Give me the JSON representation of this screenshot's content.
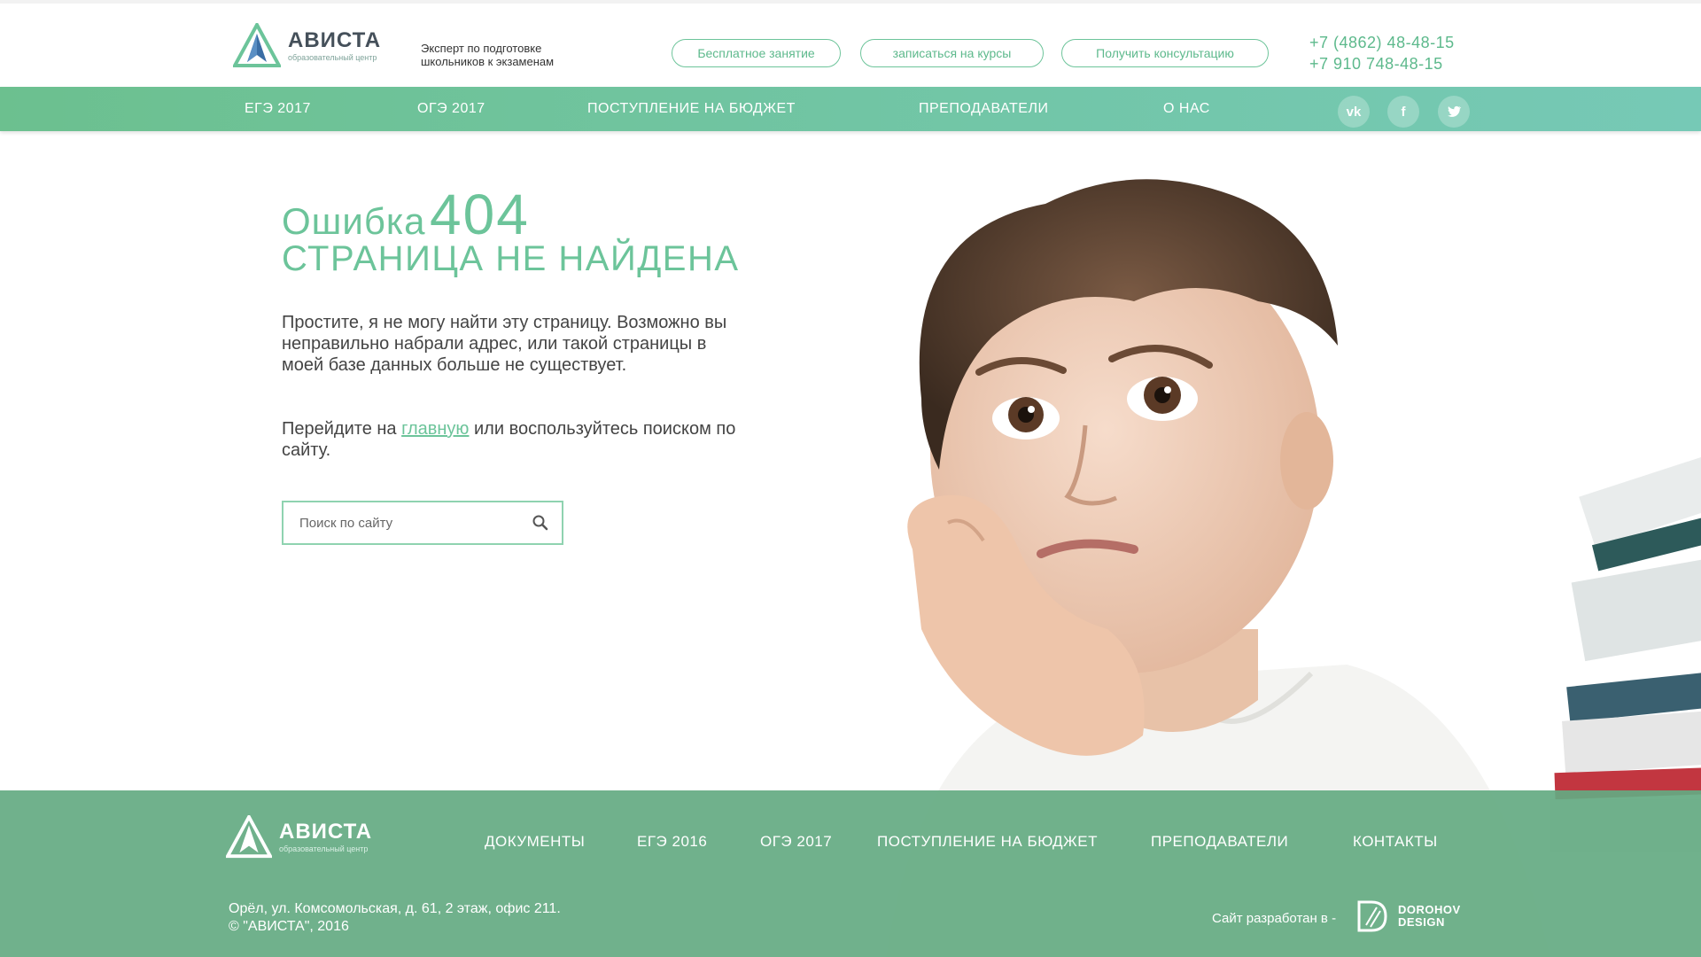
{
  "header": {
    "logo": {
      "name": "АВИСТА",
      "subtitle": "образовательный центр"
    },
    "tagline_line1": "Эксперт по подготовке",
    "tagline_line2": "школьников к экзаменам",
    "buttons": [
      "Бесплатное занятие",
      "записаться на курсы",
      "Получить консультацию"
    ],
    "phones": [
      "+7 (4862) 48-48-15",
      "+7 910 748-48-15"
    ]
  },
  "nav": {
    "items": [
      "ЕГЭ 2017",
      "ОГЭ 2017",
      "ПОСТУПЛЕНИЕ НА БЮДЖЕТ",
      "ПРЕПОДАВАТЕЛИ",
      "О НАС"
    ],
    "social": [
      {
        "label": "vk",
        "icon": "vk-icon"
      },
      {
        "label": "f",
        "icon": "facebook-icon"
      },
      {
        "label": "t",
        "icon": "twitter-icon"
      }
    ]
  },
  "main": {
    "error_word": "Ошибка",
    "error_code": "404",
    "error_subtitle": "СТРАНИЦА НЕ НАЙДЕНА",
    "message": "Простите, я не могу найти эту страницу. Возможно вы неправильно набрали адрес, или такой страницы в моей базе данных больше не существует.",
    "goto_prefix": "Перейдите на",
    "goto_link": "главную",
    "goto_suffix": "или воспользуйтесь поиском по сайту.",
    "search_placeholder": "Поиск по сайту"
  },
  "footer": {
    "logo": {
      "name": "АВИСТА",
      "subtitle": "образовательный центр"
    },
    "nav": [
      "ДОКУМЕНТЫ",
      "ЕГЭ 2016",
      "ОГЭ 2017",
      "ПОСТУПЛЕНИЕ НА БЮДЖЕТ",
      "ПРЕПОДАВАТЕЛИ",
      "КОНТАКТЫ"
    ],
    "address": "Орёл, ул. Комсомольская, д. 61, 2 этаж, офис 211.",
    "copyright": "© \"АВИСТА\", 2016",
    "developed_by": "Сайт разработан в -",
    "developer_line1": "DOROHOV",
    "developer_line2": "DESIGN"
  },
  "colors": {
    "accent": "#6cc49a",
    "footer": "#64aa82",
    "text": "#444444"
  }
}
